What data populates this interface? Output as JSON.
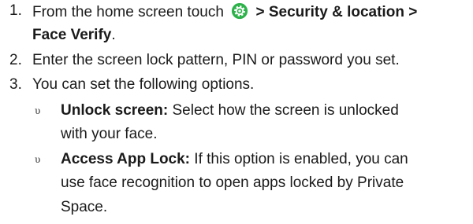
{
  "steps": [
    {
      "number": "1.",
      "lead_text": "From the home screen touch",
      "path_text": "> Security & location >",
      "path_text_2": "Face Verify",
      "tail": "."
    },
    {
      "number": "2.",
      "text": "Enter the screen lock pattern, PIN or password you set."
    },
    {
      "number": "3.",
      "text": "You can set the following options."
    }
  ],
  "options": [
    {
      "bullet": "υ",
      "title": "Unlock screen:",
      "line1": " Select how the screen is unlocked",
      "line2": "with your face."
    },
    {
      "bullet": "υ",
      "title": "Access App Lock:",
      "line1": " If this option is enabled, you can",
      "line2": "use face recognition to open apps locked by Private",
      "line3": "Space."
    }
  ],
  "icons": {
    "settings": "settings-gear-icon",
    "settings_color": "#2db24a"
  }
}
